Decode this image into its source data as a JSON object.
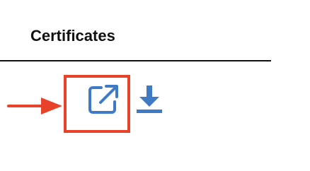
{
  "header": {
    "title": "Certificates"
  },
  "actions": {
    "open_icon": "external-link-icon",
    "download_icon": "download-icon"
  },
  "annotation": {
    "arrow_icon": "right-arrow-icon",
    "box_icon": "highlight-box"
  },
  "colors": {
    "icon": "#3f7bc4",
    "annotation": "#e8432a",
    "text": "#111111"
  }
}
